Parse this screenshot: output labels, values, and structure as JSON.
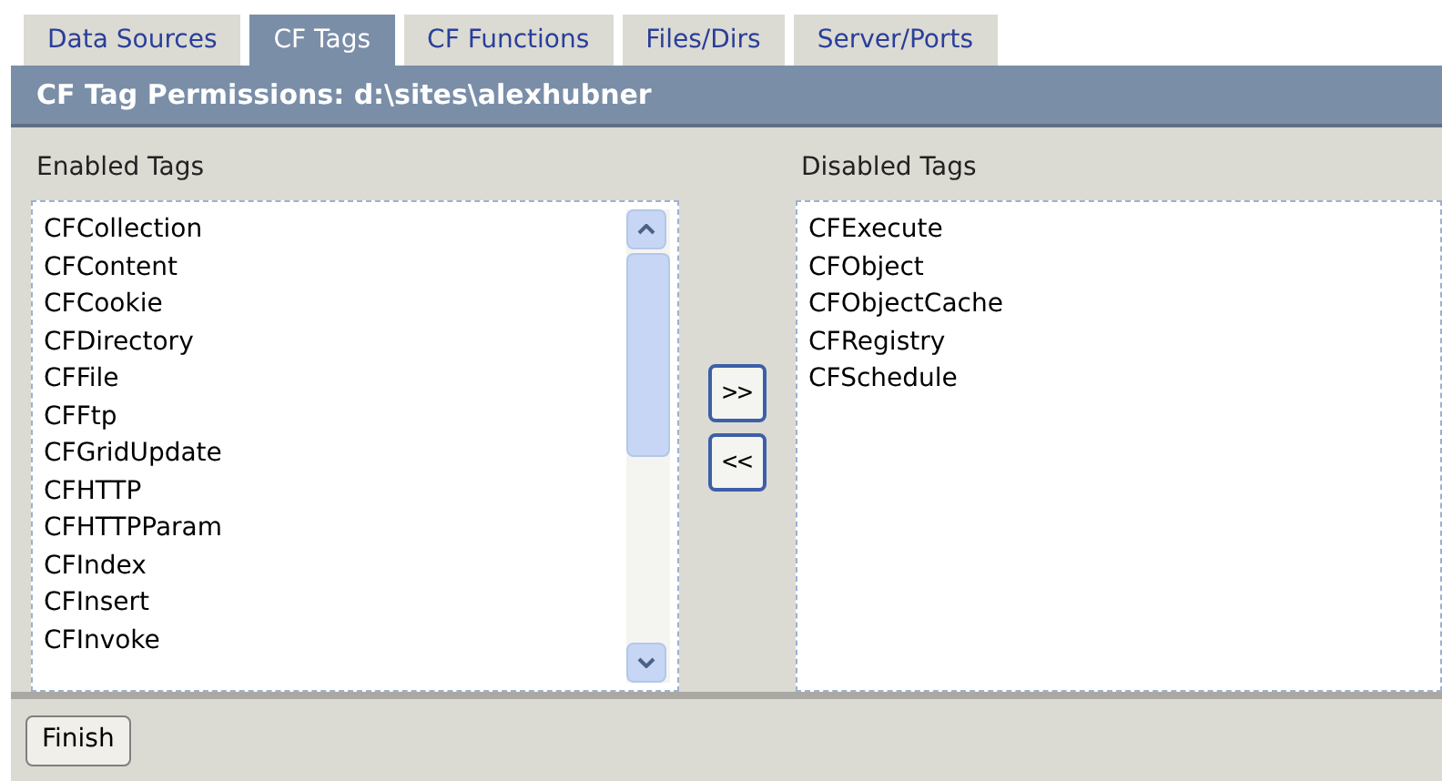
{
  "tabs": [
    {
      "label": "Data Sources",
      "selected": false
    },
    {
      "label": "CF Tags",
      "selected": true
    },
    {
      "label": "CF Functions",
      "selected": false
    },
    {
      "label": "Files/Dirs",
      "selected": false
    },
    {
      "label": "Server/Ports",
      "selected": false
    }
  ],
  "header": {
    "title": "CF Tag Permissions: d:\\sites\\alexhubner"
  },
  "enabled_tags": {
    "label": "Enabled Tags",
    "items": [
      "CFCollection",
      "CFContent",
      "CFCookie",
      "CFDirectory",
      "CFFile",
      "CFFtp",
      "CFGridUpdate",
      "CFHTTP",
      "CFHTTPParam",
      "CFIndex",
      "CFInsert",
      "CFInvoke"
    ]
  },
  "move_buttons": [
    ">>",
    "<<"
  ],
  "disabled_tags": {
    "label": "Disabled Tags",
    "items": [
      "CFExecute",
      "CFObject",
      "CFObjectCache",
      "CFRegistry",
      "CFSchedule"
    ]
  },
  "finish_button": "Finish"
}
